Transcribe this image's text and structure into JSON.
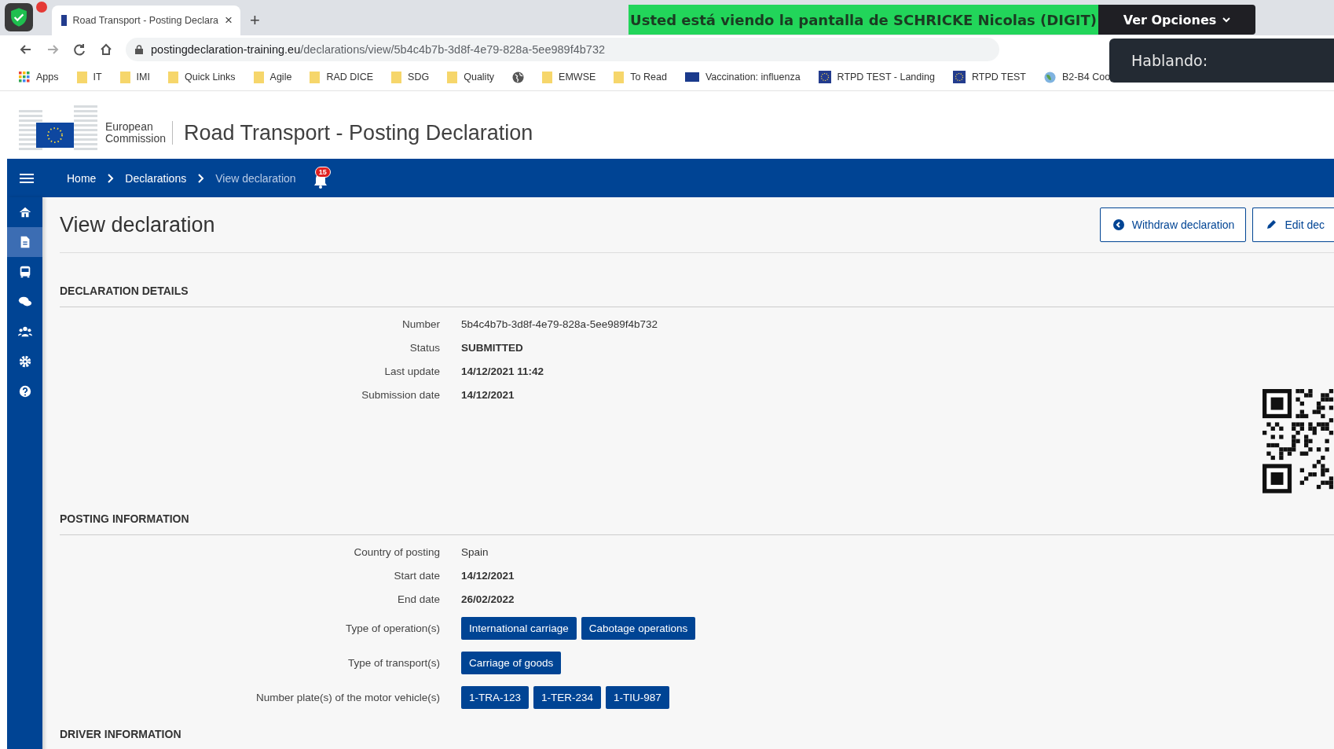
{
  "browser": {
    "tab_title": "Road Transport - Posting Declara",
    "close": "×",
    "new_tab": "+",
    "url_host": "postingdeclaration-training.eu",
    "url_path": "/declarations/view/5b4c4b7b-3d8f-4e79-828a-5ee989f4b732",
    "bookmarks": [
      {
        "kind": "apps",
        "label": "Apps"
      },
      {
        "kind": "folder",
        "label": "IT"
      },
      {
        "kind": "folder",
        "label": "IMI"
      },
      {
        "kind": "folder",
        "label": "Quick Links"
      },
      {
        "kind": "folder",
        "label": "Agile"
      },
      {
        "kind": "folder",
        "label": "RAD DICE"
      },
      {
        "kind": "folder",
        "label": "SDG"
      },
      {
        "kind": "folder",
        "label": "Quality"
      },
      {
        "kind": "globe"
      },
      {
        "kind": "folder",
        "label": "EMWSE"
      },
      {
        "kind": "folder",
        "label": "To Read"
      },
      {
        "kind": "flag",
        "label": "Vaccination: influenza"
      },
      {
        "kind": "emblem",
        "label": "RTPD TEST - Landing"
      },
      {
        "kind": "emblem",
        "label": "RTPD TEST"
      },
      {
        "kind": "earth",
        "label": "B2-B4 Coo"
      }
    ]
  },
  "screen_share": {
    "banner": "Usted está viendo la pantalla de SCHRICKE Nicolas (DIGIT)",
    "options": "Ver Opciones",
    "speaking": "Hablando:"
  },
  "header": {
    "org_line_1": "European",
    "org_line_2": "Commission",
    "title": "Road Transport - Posting Declaration"
  },
  "nav": {
    "breadcrumbs": [
      {
        "label": "Home",
        "current": false
      },
      {
        "label": "Declarations",
        "current": false
      },
      {
        "label": "View declaration",
        "current": true
      }
    ],
    "notifications": "15"
  },
  "sidebar": {
    "items": [
      {
        "kind": "home",
        "selected": false
      },
      {
        "kind": "document",
        "selected": true
      },
      {
        "kind": "bus",
        "selected": false
      },
      {
        "kind": "chat",
        "selected": false
      },
      {
        "kind": "users",
        "selected": false
      },
      {
        "kind": "gear",
        "selected": false
      },
      {
        "kind": "help",
        "selected": false
      }
    ]
  },
  "page": {
    "title": "View declaration",
    "actions": [
      {
        "kind": "withdraw",
        "label": "Withdraw declaration"
      },
      {
        "kind": "edit",
        "label": "Edit dec"
      }
    ],
    "sections": [
      {
        "heading": "DECLARATION DETAILS",
        "qr_code": true,
        "fields": [
          {
            "label": "Number",
            "kind": "plain",
            "value": "5b4c4b7b-3d8f-4e79-828a-5ee989f4b732"
          },
          {
            "label": "Status",
            "kind": "strong",
            "value": "SUBMITTED"
          },
          {
            "label": "Last update",
            "kind": "strong",
            "value": "14/12/2021 11:42"
          },
          {
            "label": "Submission date",
            "kind": "strong",
            "value": "14/12/2021"
          }
        ]
      },
      {
        "heading": "POSTING INFORMATION",
        "fields": [
          {
            "label": "Country of posting",
            "kind": "plain",
            "value": "Spain"
          },
          {
            "label": "Start date",
            "kind": "strong",
            "value": "14/12/2021"
          },
          {
            "label": "End date",
            "kind": "strong",
            "value": "26/02/2022"
          },
          {
            "label": "Type of operation(s)",
            "kind": "tags",
            "tags": [
              "International carriage",
              "Cabotage operations"
            ]
          },
          {
            "label": "Type of transport(s)",
            "kind": "tags",
            "tags": [
              "Carriage of goods"
            ]
          },
          {
            "label": "Number plate(s) of the motor vehicle(s)",
            "kind": "tags",
            "tags": [
              "1-TRA-123",
              "1-TER-234",
              "1-TIU-987"
            ]
          }
        ]
      },
      {
        "heading": "DRIVER INFORMATION"
      }
    ]
  }
}
